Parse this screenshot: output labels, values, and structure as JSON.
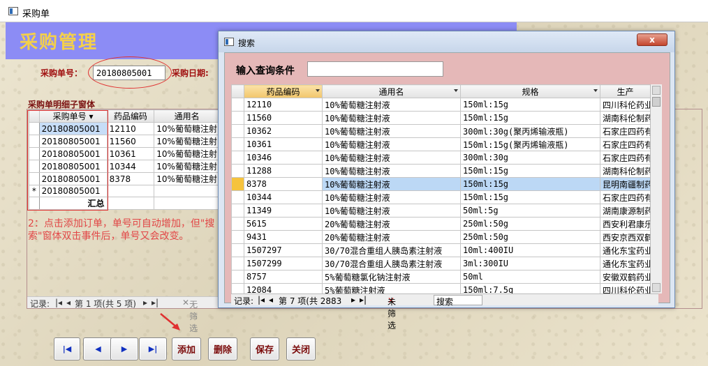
{
  "app": {
    "title": "采购单"
  },
  "header": {
    "title": "采购管理"
  },
  "order": {
    "no_label": "采购单号：",
    "no_value": "20180805001",
    "date_label": "采购日期:"
  },
  "subform": {
    "title": "采购单明细子窗体",
    "columns": [
      "采购单号",
      "药品编码",
      "通用名"
    ],
    "rows": [
      [
        "20180805001",
        "12110",
        "10%葡萄糖注射"
      ],
      [
        "20180805001",
        "11560",
        "10%葡萄糖注射"
      ],
      [
        "20180805001",
        "10361",
        "10%葡萄糖注射"
      ],
      [
        "20180805001",
        "10344",
        "10%葡萄糖注射"
      ],
      [
        "20180805001",
        "8378",
        "10%葡萄糖注射"
      ]
    ],
    "new_row_marker": "*",
    "new_row_value": "20180805001",
    "total_label": "汇总",
    "nav": {
      "label": "记录:",
      "position": "第 1 项(共 5 项)",
      "filter": "无筛选"
    }
  },
  "note": "2：点击添加订单，单号可自动增加，但\"搜索\"窗体双击事件后，单号又会改变。",
  "buttons": {
    "first": "|◀",
    "prev": "◀",
    "next": "▶",
    "last": "▶|",
    "add": "添加",
    "delete": "删除",
    "save": "保存",
    "close": "关闭"
  },
  "dialog": {
    "title": "搜索",
    "close": "x",
    "query_label": "输入查询条件",
    "query_value": "",
    "columns": [
      "药品编码",
      "通用名",
      "规格",
      "生产"
    ],
    "rows": [
      [
        "12110",
        "10%葡萄糖注射液",
        "150ml:15g",
        "四川科伦药业"
      ],
      [
        "11560",
        "10%葡萄糖注射液",
        "150ml:15g",
        "湖南科伦制药"
      ],
      [
        "10362",
        "10%葡萄糖注射液",
        "300ml:30g(聚丙烯输液瓶)",
        "石家庄四药有"
      ],
      [
        "10361",
        "10%葡萄糖注射液",
        "150ml:15g(聚丙烯输液瓶)",
        "石家庄四药有"
      ],
      [
        "10346",
        "10%葡萄糖注射液",
        "300ml:30g",
        "石家庄四药有"
      ],
      [
        "11288",
        "10%葡萄糖注射液",
        "150ml:15g",
        "湖南科伦制药"
      ],
      [
        "8378",
        "10%葡萄糖注射液",
        "150ml:15g",
        "昆明南疆制药"
      ],
      [
        "10344",
        "10%葡萄糖注射液",
        "150ml:15g",
        "石家庄四药有"
      ],
      [
        "11349",
        "10%葡萄糖注射液",
        "50ml:5g",
        "湖南康源制药"
      ],
      [
        "5615",
        "20%葡萄糖注射液",
        "250ml:50g",
        "西安利君康乐"
      ],
      [
        "9431",
        "20%葡萄糖注射液",
        "250ml:50g",
        "西安京西双鹤"
      ],
      [
        "1507297",
        "30/70混合重组人胰岛素注射液",
        "10ml:400IU",
        "通化东宝药业"
      ],
      [
        "1507299",
        "30/70混合重组人胰岛素注射液",
        "3ml:300IU",
        "通化东宝药业"
      ],
      [
        "8757",
        "5%葡萄糖氯化钠注射液",
        "50ml",
        "安徽双鹤药业"
      ],
      [
        "12084",
        "5%葡萄糖注射液",
        "150ml:7.5g",
        "四川科伦药业"
      ]
    ],
    "highlight_row": 6,
    "nav": {
      "label": "记录:",
      "position": "第 7 项(共 2883",
      "filter": "未筛选",
      "search": "搜索"
    }
  }
}
